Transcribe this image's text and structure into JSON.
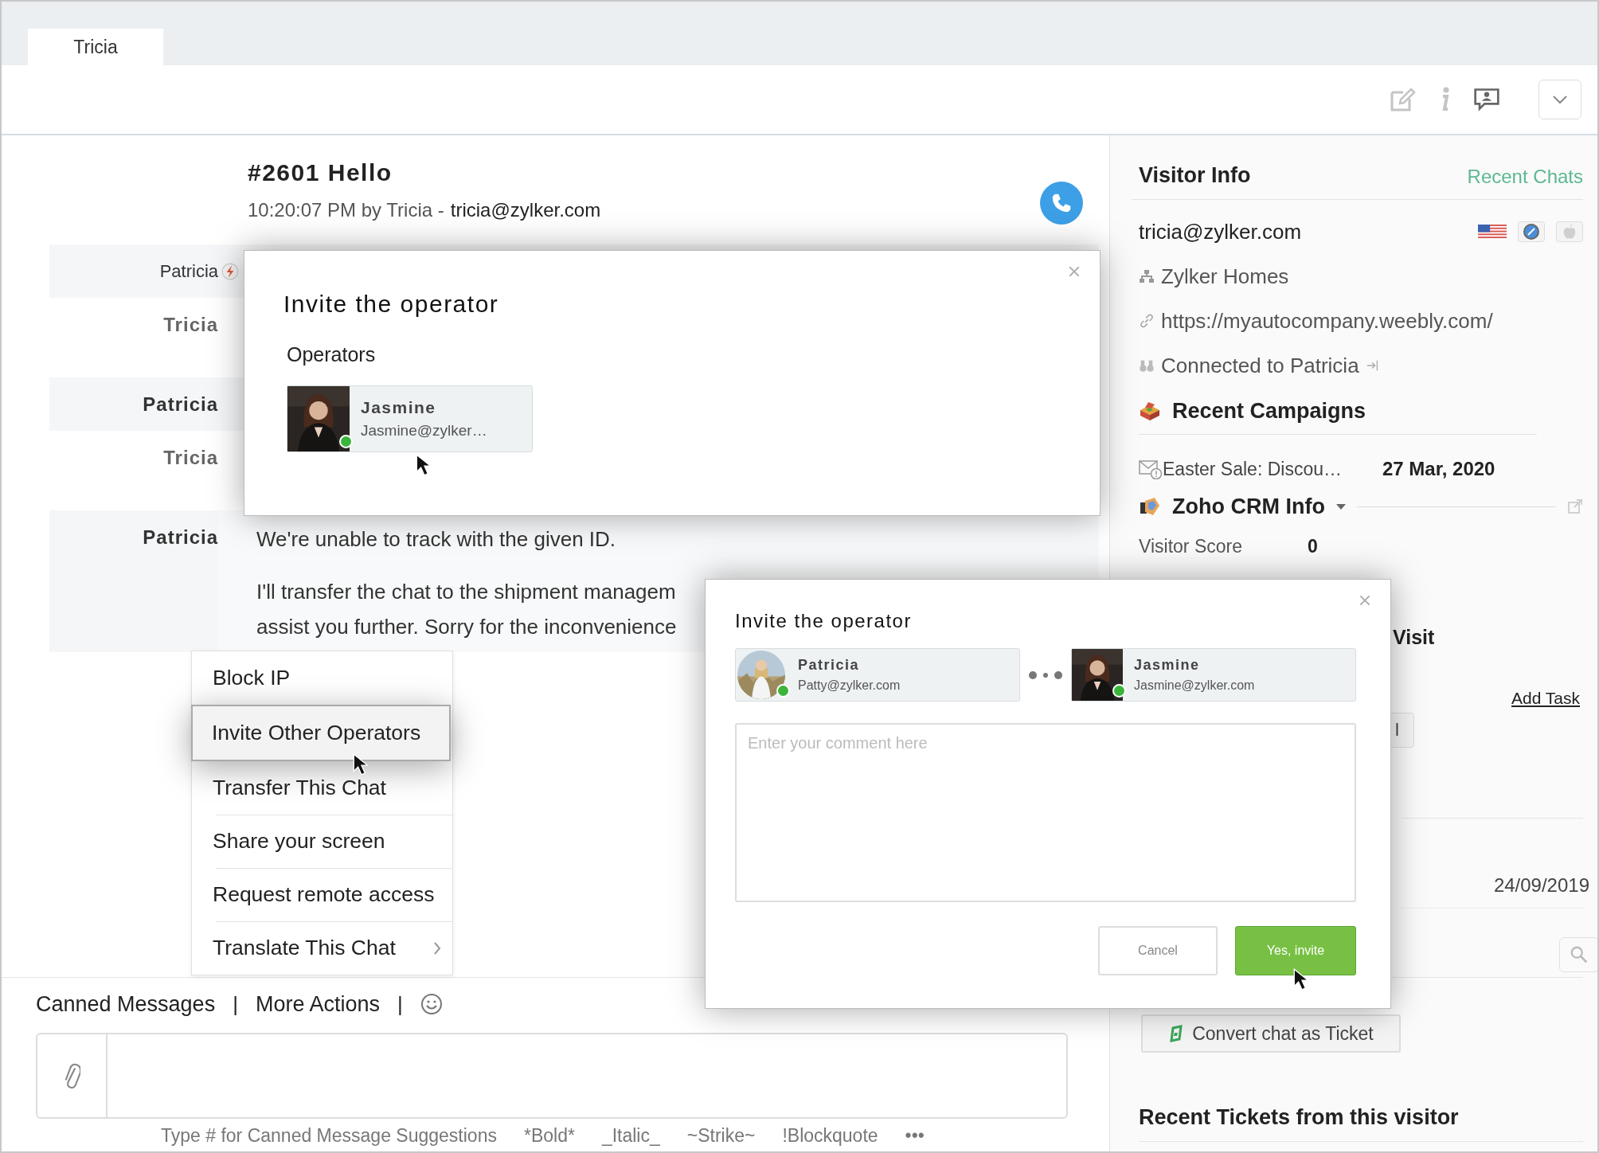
{
  "tabs": [
    {
      "label": "Tricia",
      "selected": true
    }
  ],
  "chat": {
    "title": "#2601 Hello",
    "meta": "10:20:07 PM by Tricia -",
    "email": "tricia@zylker.com",
    "rows": [
      {
        "sender": "Patricia",
        "kind": "trigger"
      },
      {
        "sender": "Tricia",
        "kind": "operator"
      },
      {
        "sender": "Patricia",
        "kind": "visitor"
      },
      {
        "sender": "Tricia",
        "kind": "operator"
      },
      {
        "sender": "Patricia",
        "kind": "visitor",
        "lines": [
          "We're unable to track with the given ID.",
          "I'll transfer the chat to the shipment managem",
          "assist you further. Sorry for the inconvenience"
        ]
      }
    ]
  },
  "menu": {
    "items": [
      {
        "label": "Block IP",
        "selected": false,
        "submenu": false
      },
      {
        "label": "Invite Other Operators",
        "selected": true,
        "submenu": false
      },
      {
        "label": "Transfer This Chat",
        "selected": false,
        "submenu": false
      },
      {
        "label": "Share your screen",
        "selected": false,
        "submenu": false
      },
      {
        "label": "Request remote access",
        "selected": false,
        "submenu": false
      },
      {
        "label": "Translate This Chat",
        "selected": false,
        "submenu": true
      }
    ]
  },
  "composer": {
    "actions": [
      {
        "label": "Canned Messages",
        "divider": "|"
      },
      {
        "label": "More Actions",
        "divider": "|"
      }
    ],
    "hints": [
      "Type # for Canned Message Suggestions",
      "*Bold*",
      "_Italic_",
      "~Strike~",
      "!Blockquote",
      "•••"
    ]
  },
  "invite_dialog": {
    "title": "Invite the operator",
    "section": "Operators",
    "operators": [
      {
        "name": "Jasmine",
        "email": "Jasmine@zylker…",
        "online": true
      }
    ]
  },
  "confirm_dialog": {
    "title": "Invite the operator",
    "from": {
      "name": "Patricia",
      "email": "Patty@zylker.com",
      "online": true
    },
    "to": {
      "name": "Jasmine",
      "email": "Jasmine@zylker.com",
      "online": true
    },
    "comment": {
      "placeholder": "Enter your comment here"
    },
    "cancel": "Cancel",
    "confirm": "Yes, invite"
  },
  "visitor_info": {
    "title": "Visitor Info",
    "recent_chats": "Recent Chats",
    "email": "tricia@zylker.com",
    "company": "Zylker Homes",
    "url": "https://myautocompany.weebly.com/",
    "connection": "Connected to Patricia",
    "campaigns_title": "Recent Campaigns",
    "campaign": {
      "name": "Easter Sale: Discou…",
      "date": "27 Mar, 2020"
    },
    "crm_title": "Zoho CRM Info",
    "score_label": "Visitor Score",
    "score": "0",
    "visit_heading": "Visit",
    "add_task": "Add Task",
    "partial_button": "l",
    "date": "24/09/2019",
    "convert": "Convert chat as Ticket",
    "tickets_title": "Recent Tickets from this visitor"
  }
}
